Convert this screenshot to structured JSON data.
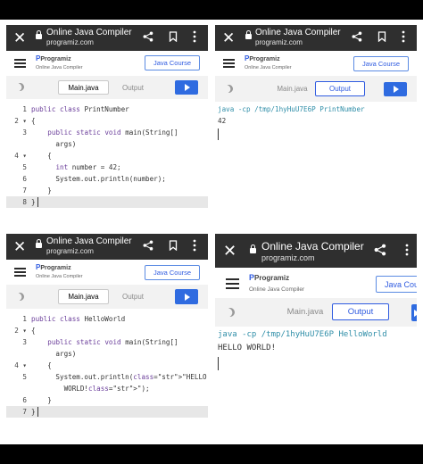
{
  "panels": [
    {
      "browser": {
        "title": "Online Java Compiler",
        "url": "programiz.com"
      },
      "site": {
        "logo": "Programiz",
        "logo_subtitle": "Online Java Compiler",
        "course_button": "Java Course"
      },
      "tabs": {
        "main": "Main.java",
        "output": "Output",
        "active": "main"
      },
      "code": [
        {
          "num": "1",
          "text": "public class PrintNumber"
        },
        {
          "num": "2 ▾",
          "text": "{"
        },
        {
          "num": "3",
          "text": "    public static void main(String[]"
        },
        {
          "num": "",
          "text": "      args)"
        },
        {
          "num": "4 ▾",
          "text": "    {"
        },
        {
          "num": "5",
          "text": "      int number = 42;"
        },
        {
          "num": "6",
          "text": "      System.out.println(number);"
        },
        {
          "num": "7",
          "text": "    }"
        },
        {
          "num": "8",
          "text": "}"
        }
      ]
    },
    {
      "browser": {
        "title": "Online Java Compiler",
        "url": "programiz.com"
      },
      "site": {
        "logo": "Programiz",
        "logo_subtitle": "Online Java Compiler",
        "course_button": "Java Course"
      },
      "tabs": {
        "main": "Main.java",
        "output": "Output",
        "active": "output"
      },
      "output": [
        "java -cp /tmp/1hyHuU7E6P PrintNumber",
        "42"
      ]
    },
    {
      "browser": {
        "title": "Online Java Compiler",
        "url": "programiz.com"
      },
      "site": {
        "logo": "Programiz",
        "logo_subtitle": "Online Java Compiler",
        "course_button": "Java Course"
      },
      "tabs": {
        "main": "Main.java",
        "output": "Output",
        "active": "main"
      },
      "code": [
        {
          "num": "1",
          "text": "public class HelloWorld"
        },
        {
          "num": "2 ▾",
          "text": "{"
        },
        {
          "num": "3",
          "text": "    public static void main(String[]"
        },
        {
          "num": "",
          "text": "      args)"
        },
        {
          "num": "4 ▾",
          "text": "    {"
        },
        {
          "num": "5",
          "text": "      System.out.println(\"HELLO"
        },
        {
          "num": "",
          "text": "        WORLD!\");"
        },
        {
          "num": "6",
          "text": "    }"
        },
        {
          "num": "7",
          "text": "}"
        }
      ]
    },
    {
      "browser": {
        "title": "Online Java Compiler",
        "url": "programiz.com"
      },
      "site": {
        "logo": "Programiz",
        "logo_subtitle": "Online Java Compiler",
        "course_button": "Java Cou"
      },
      "tabs": {
        "main": "Main.java",
        "output": "Output",
        "active": "output"
      },
      "output": [
        "java -cp /tmp/1hyHuU7E6P HelloWorld",
        "HELLO WORLD!"
      ]
    }
  ]
}
